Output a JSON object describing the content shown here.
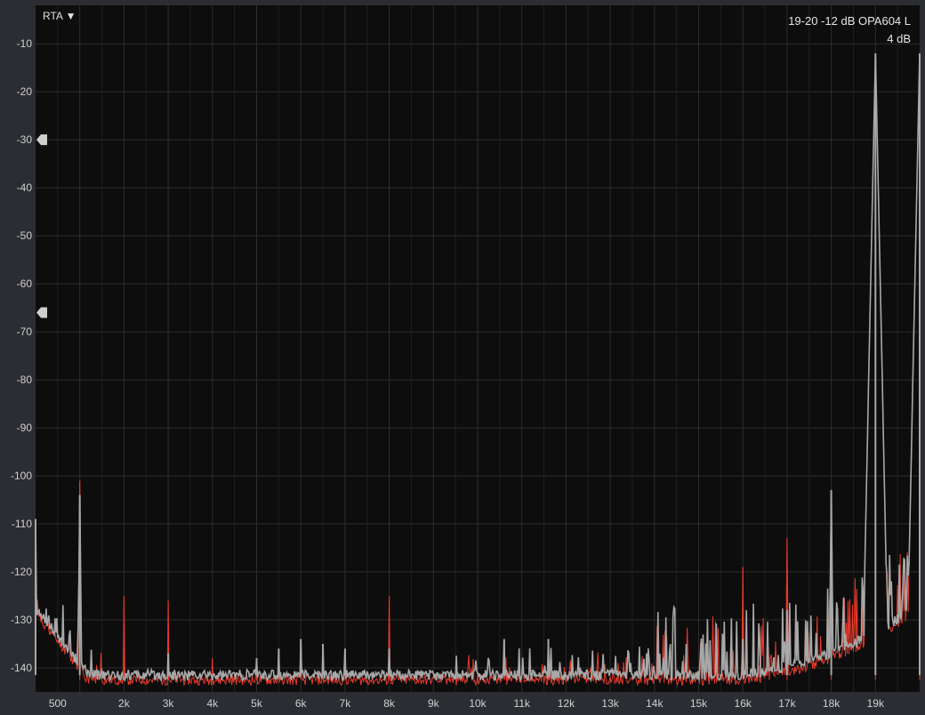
{
  "menu": {
    "rta_label": "RTA ▼"
  },
  "chart_data": {
    "type": "line",
    "title": "19-20 -12 dB OPA604 L",
    "subtitle": "4 dB",
    "xlabel": "",
    "ylabel": "",
    "xlim": [
      0,
      20000
    ],
    "ylim": [
      -145,
      -2
    ],
    "grid": true,
    "y_ticks": [
      -10,
      -20,
      -30,
      -40,
      -50,
      -60,
      -70,
      -80,
      -90,
      -100,
      -110,
      -120,
      -130,
      -140
    ],
    "x_ticks": [
      {
        "value": 500,
        "label": "500"
      },
      {
        "value": 2000,
        "label": "2k"
      },
      {
        "value": 3000,
        "label": "3k"
      },
      {
        "value": 4000,
        "label": "4k"
      },
      {
        "value": 5000,
        "label": "5k"
      },
      {
        "value": 6000,
        "label": "6k"
      },
      {
        "value": 7000,
        "label": "7k"
      },
      {
        "value": 8000,
        "label": "8k"
      },
      {
        "value": 9000,
        "label": "9k"
      },
      {
        "value": 10000,
        "label": "10k"
      },
      {
        "value": 11000,
        "label": "11k"
      },
      {
        "value": 12000,
        "label": "12k"
      },
      {
        "value": 13000,
        "label": "13k"
      },
      {
        "value": 14000,
        "label": "14k"
      },
      {
        "value": 15000,
        "label": "15k"
      },
      {
        "value": 16000,
        "label": "16k"
      },
      {
        "value": 17000,
        "label": "17k"
      },
      {
        "value": 18000,
        "label": "18k"
      },
      {
        "value": 19000,
        "label": "19k"
      }
    ],
    "markers": [
      -30,
      -66
    ],
    "series": [
      {
        "color": "#e83a2c",
        "noise_floor": -142.5,
        "peaks": [
          [
            1000,
            -101
          ],
          [
            2000,
            -125
          ],
          [
            3000,
            -126
          ],
          [
            4000,
            -138
          ],
          [
            5000,
            -140
          ],
          [
            5500,
            -140
          ],
          [
            6000,
            -138
          ],
          [
            7000,
            -139
          ],
          [
            8000,
            -125
          ],
          [
            10600,
            -140
          ],
          [
            11600,
            -140
          ],
          [
            12700,
            -140
          ],
          [
            16000,
            -119
          ],
          [
            17000,
            -113
          ],
          [
            18000,
            -104
          ],
          [
            19000,
            -12
          ],
          [
            20000,
            -12
          ]
        ]
      },
      {
        "color": "#a8a8a8",
        "noise_floor": -141.5,
        "peaks": [
          [
            0,
            -109
          ],
          [
            1000,
            -104
          ],
          [
            3000,
            -137
          ],
          [
            5000,
            -138
          ],
          [
            5500,
            -136
          ],
          [
            6000,
            -134
          ],
          [
            6500,
            -135
          ],
          [
            7000,
            -136
          ],
          [
            8000,
            -136
          ],
          [
            10600,
            -134
          ],
          [
            11600,
            -134
          ],
          [
            16000,
            -134
          ],
          [
            17000,
            -128
          ],
          [
            18000,
            -103
          ],
          [
            19000,
            -12
          ],
          [
            20000,
            -12
          ]
        ]
      }
    ]
  }
}
